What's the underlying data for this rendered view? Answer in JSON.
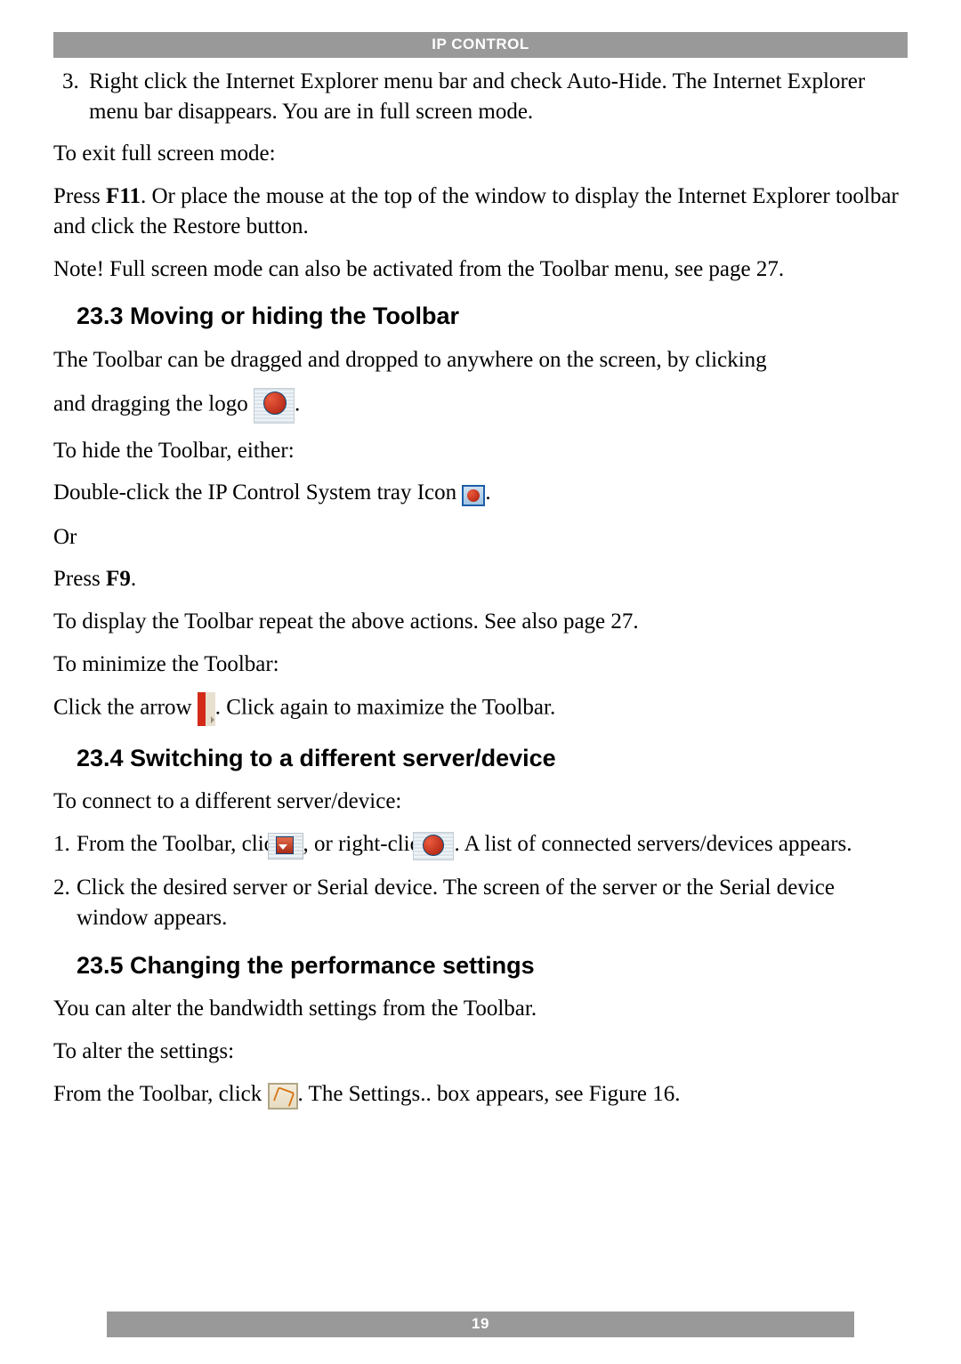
{
  "header": {
    "title": "IP CONTROL"
  },
  "footer": {
    "page_number": "19"
  },
  "body": {
    "item3_number": "3.",
    "item3_text_a": "Right click the Internet Explorer menu bar and check Auto-Hide. The Internet Explorer menu bar disappears. You are in full screen mode.",
    "exit_fullscreen_label": "To exit full screen mode:",
    "press_f11_a": "Press ",
    "press_f11_key": "F11",
    "press_f11_b": ". Or place the mouse at the top of the window to display the Internet Explorer toolbar and click the Restore button.",
    "note_fullscreen": "Note! Full screen mode can also be activated from the Toolbar menu, see page 27.",
    "h23_3": "23.3 Moving or hiding the Toolbar",
    "drag_intro": "The Toolbar can be dragged and dropped to anywhere on the screen, by clicking",
    "drag_logo_a": "and dragging the logo ",
    "drag_logo_b": ".",
    "hide_label": "To hide the Toolbar, either:",
    "doubleclick_a": "Double-click the IP Control System tray Icon ",
    "doubleclick_b": ".",
    "or_label": "Or",
    "press_f9_a": "Press ",
    "press_f9_key": "F9",
    "press_f9_b": ".",
    "display_repeat": "To display the Toolbar repeat the above actions. See also page 27.",
    "minimize_label": "To minimize the Toolbar:",
    "click_arrow_a": "Click the arrow ",
    "click_arrow_b": ". Click again to maximize the Toolbar.",
    "h23_4": "23.4 Switching to a different server/device",
    "connect_label": "To connect to a different server/device:",
    "step1_num": "1.",
    "step1_a": "From the Toolbar, click ",
    "step1_b": ", or right-click ",
    "step1_c": ". A list of connected servers/devices appears.",
    "step2_num": "2.",
    "step2": "Click the desired server or Serial device. The screen of the server or the Serial device window appears.",
    "h23_5": "23.5 Changing the performance settings",
    "alter_bandwidth": "You can alter the bandwidth settings from the Toolbar.",
    "alter_label": "To alter the settings:",
    "from_toolbar_a": "From the Toolbar, click ",
    "from_toolbar_b": ". The Settings.. box appears, see Figure 16."
  }
}
